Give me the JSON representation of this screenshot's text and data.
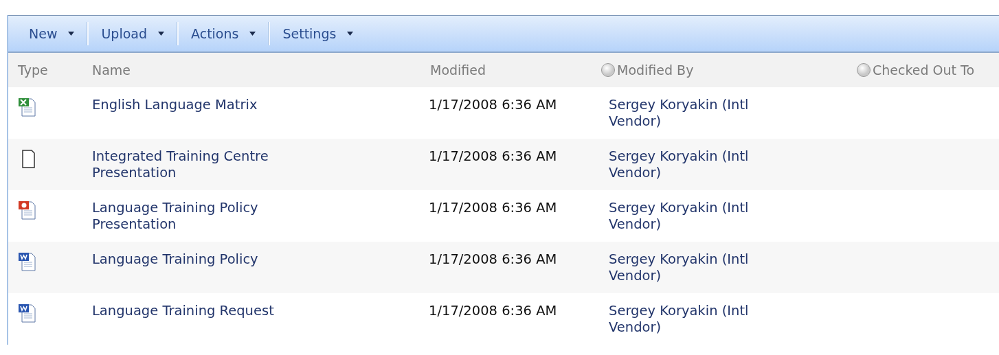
{
  "toolbar": [
    {
      "label": "New",
      "has_menu": true
    },
    {
      "label": "Upload",
      "has_menu": true
    },
    {
      "label": "Actions",
      "has_menu": true
    },
    {
      "label": "Settings",
      "has_menu": true
    }
  ],
  "table": {
    "columns": [
      {
        "label": "Type",
        "sortable": false
      },
      {
        "label": "Name",
        "sortable": false
      },
      {
        "label": "Modified",
        "sortable": false
      },
      {
        "label": "Modified By",
        "sortable": true
      },
      {
        "label": "Checked Out To",
        "sortable": true
      }
    ],
    "rows": [
      {
        "kind": "excel",
        "name": "English Language Matrix",
        "modified": "1/17/2008 6:36 AM",
        "modified_by": "Sergey Koryakin (Intl Vendor)"
      },
      {
        "kind": "blank",
        "name": "Integrated Training Centre Presentation",
        "modified": "1/17/2008 6:36 AM",
        "modified_by": "Sergey Koryakin (Intl Vendor)"
      },
      {
        "kind": "powerpoint",
        "name": "Language Training Policy Presentation",
        "modified": "1/17/2008 6:36 AM",
        "modified_by": "Sergey Koryakin (Intl Vendor)"
      },
      {
        "kind": "word",
        "name": "Language Training Policy",
        "modified": "1/17/2008 6:36 AM",
        "modified_by": "Sergey Koryakin (Intl Vendor)"
      },
      {
        "kind": "word",
        "name": "Language Training Request",
        "modified": "1/17/2008 6:36 AM",
        "modified_by": "Sergey Koryakin (Intl Vendor)"
      }
    ]
  }
}
